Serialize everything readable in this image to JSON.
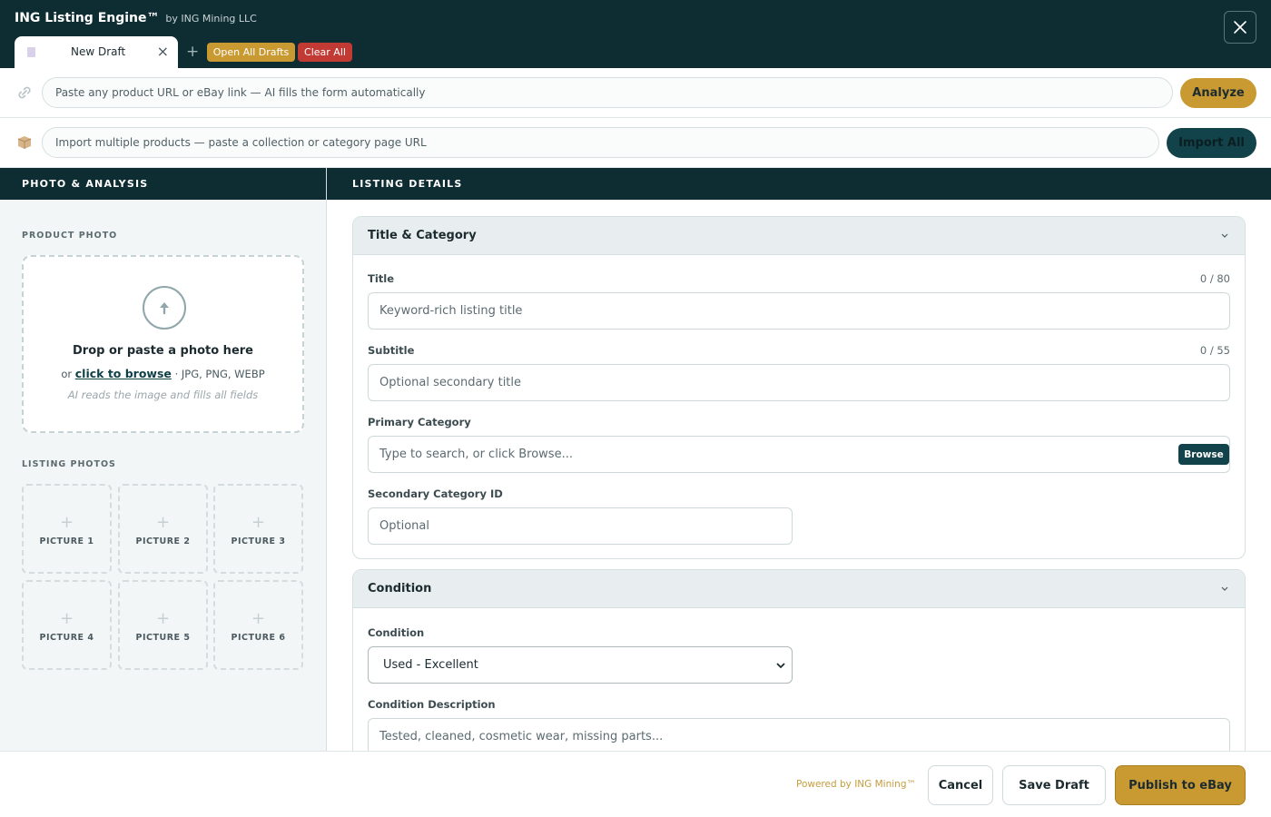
{
  "app": {
    "title": "ING Listing Engine™",
    "subtitle": "by ING Mining LLC"
  },
  "tabs": [
    {
      "label": "New Draft",
      "icon": "document-icon"
    }
  ],
  "toolbar": {
    "add_tab": "+",
    "open_all_label": "Open All Drafts",
    "clear_all_label": "Clear All",
    "close_icon": "close-icon"
  },
  "url_bar": {
    "placeholder": "Paste any product URL or eBay link — AI fills the form automatically",
    "button_label": "Analyze",
    "icon": "link-icon"
  },
  "import_bar": {
    "placeholder": "Import multiple products — paste a collection or category page URL",
    "button_label": "Import All",
    "icon": "package-icon"
  },
  "left_panel": {
    "header": "PHOTO & ANALYSIS",
    "product_photo_label": "PRODUCT PHOTO",
    "dropzone": {
      "title": "Drop or paste a photo here",
      "or": "or",
      "browse_link": "click to browse",
      "formats": "· JPG, PNG, WEBP",
      "hint": "AI reads the image and fills all fields"
    },
    "listing_photos_label": "LISTING PHOTOS",
    "pictures": [
      "PICTURE 1",
      "PICTURE 2",
      "PICTURE 3",
      "PICTURE 4",
      "PICTURE 5",
      "PICTURE 6"
    ]
  },
  "right_panel": {
    "header": "LISTING DETAILS",
    "title_category": {
      "section_title": "Title & Category",
      "title_label": "Title",
      "title_count": "0 / 80",
      "title_placeholder": "Keyword-rich listing title",
      "subtitle_label": "Subtitle",
      "subtitle_count": "0 / 55",
      "subtitle_placeholder": "Optional secondary title",
      "primary_category_label": "Primary Category",
      "primary_category_placeholder": "Type to search, or click Browse...",
      "browse_label": "Browse",
      "secondary_category_label": "Secondary Category ID",
      "secondary_category_placeholder": "Optional"
    },
    "condition": {
      "section_title": "Condition",
      "condition_label": "Condition",
      "condition_value": "Used - Excellent",
      "description_label": "Condition Description",
      "description_placeholder": "Tested, cleaned, cosmetic wear, missing parts..."
    }
  },
  "footer": {
    "powered_by": "Powered by ING Mining™",
    "cancel_label": "Cancel",
    "save_label": "Save Draft",
    "publish_label": "Publish to eBay"
  },
  "colors": {
    "header_bg": "#0e2d33",
    "accent_gold": "#c99a32",
    "danger_red": "#c13a34",
    "teal_button": "#12434a"
  }
}
